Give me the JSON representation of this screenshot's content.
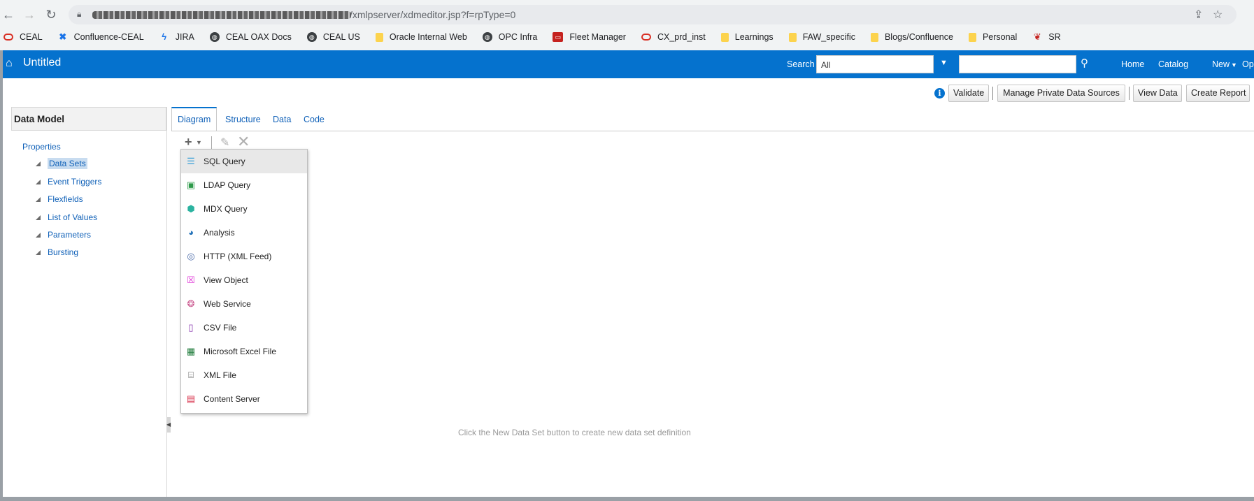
{
  "browser": {
    "url_visible": "/xmlpserver/xdmeditor.jsp?f=rpType=0",
    "bookmarks": [
      {
        "label": "CEAL",
        "icon": "oracle-ring-icon"
      },
      {
        "label": "Confluence-CEAL",
        "icon": "confluence-icon"
      },
      {
        "label": "JIRA",
        "icon": "jira-icon"
      },
      {
        "label": "CEAL OAX Docs",
        "icon": "globe-icon"
      },
      {
        "label": "CEAL US",
        "icon": "globe-icon"
      },
      {
        "label": "Oracle Internal Web",
        "icon": "folder-icon"
      },
      {
        "label": "OPC Infra",
        "icon": "globe-icon"
      },
      {
        "label": "Fleet Manager",
        "icon": "fleet-icon"
      },
      {
        "label": "CX_prd_inst",
        "icon": "oracle-ring-icon"
      },
      {
        "label": "Learnings",
        "icon": "folder-icon"
      },
      {
        "label": "FAW_specific",
        "icon": "folder-icon"
      },
      {
        "label": "Blogs/Confluence",
        "icon": "folder-icon"
      },
      {
        "label": "Personal",
        "icon": "folder-icon"
      },
      {
        "label": "SR",
        "icon": "sr-icon"
      }
    ]
  },
  "header": {
    "title": "Untitled",
    "search_label": "Search",
    "search_scope": "All",
    "nav": [
      "Home",
      "Catalog",
      "New",
      "Op"
    ]
  },
  "actions": {
    "validate": "Validate",
    "manage_sources": "Manage Private Data Sources",
    "view_data": "View Data",
    "create_report": "Create Report"
  },
  "left_panel": {
    "title": "Data Model",
    "properties": "Properties",
    "items": [
      "Data Sets",
      "Event Triggers",
      "Flexfields",
      "List of Values",
      "Parameters",
      "Bursting"
    ]
  },
  "tabs": [
    "Diagram",
    "Structure",
    "Data",
    "Code"
  ],
  "menu": {
    "items": [
      {
        "label": "SQL Query",
        "icon": "sql-query-icon",
        "color": "#3aa0d8"
      },
      {
        "label": "LDAP Query",
        "icon": "ldap-query-icon",
        "color": "#2e9a4a"
      },
      {
        "label": "MDX Query",
        "icon": "mdx-cube-icon",
        "color": "#2bb3a0"
      },
      {
        "label": "Analysis",
        "icon": "analysis-icon",
        "color": "#1f6fb8"
      },
      {
        "label": "HTTP (XML Feed)",
        "icon": "http-feed-icon",
        "color": "#4a6aa8"
      },
      {
        "label": "View Object",
        "icon": "view-object-icon",
        "color": "#e03ad8"
      },
      {
        "label": "Web Service",
        "icon": "web-service-icon",
        "color": "#c8508a"
      },
      {
        "label": "CSV File",
        "icon": "csv-file-icon",
        "color": "#8a3ab0"
      },
      {
        "label": "Microsoft Excel File",
        "icon": "excel-file-icon",
        "color": "#1e7b3a"
      },
      {
        "label": "XML File",
        "icon": "xml-file-icon",
        "color": "#555555"
      },
      {
        "label": "Content Server",
        "icon": "content-server-icon",
        "color": "#d8304a"
      }
    ]
  },
  "empty_message": "Click the New Data Set button to create new data set definition",
  "colors": {
    "header_blue": "#0572ce",
    "link_blue": "#1061b8"
  }
}
